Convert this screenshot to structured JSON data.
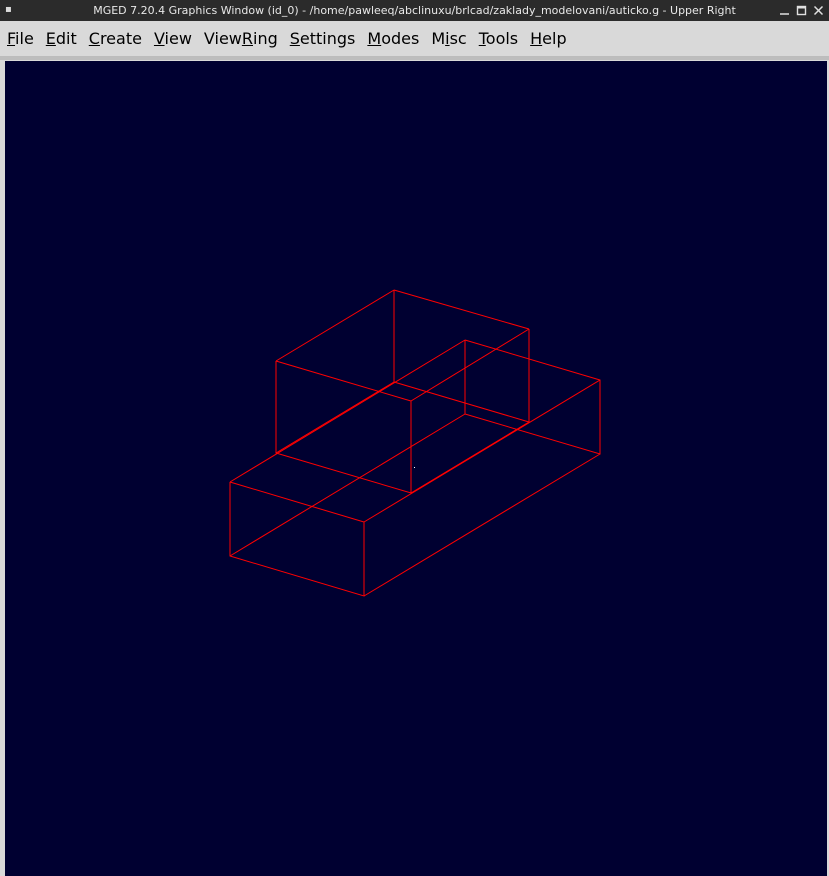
{
  "window": {
    "title": "MGED 7.20.4 Graphics Window (id_0) - /home/pawleeq/abclinuxu/brlcad/zaklady_modelovani/auticko.g - Upper Right",
    "menu_glyph": "▪",
    "controls": {
      "minimize_icon": "minimize-icon",
      "maximize_icon": "maximize-icon",
      "close_icon": "close-icon"
    }
  },
  "menubar": {
    "items": [
      {
        "label": "File",
        "mnemonic": "F",
        "rest": "ile"
      },
      {
        "label": "Edit",
        "mnemonic": "E",
        "rest": "dit"
      },
      {
        "label": "Create",
        "mnemonic": "C",
        "rest": "reate"
      },
      {
        "label": "View",
        "mnemonic": "V",
        "rest": "iew"
      },
      {
        "label": "ViewRing",
        "before": "View",
        "mnemonic": "R",
        "rest": "ing"
      },
      {
        "label": "Settings",
        "mnemonic": "S",
        "rest": "ettings"
      },
      {
        "label": "Modes",
        "mnemonic": "M",
        "rest": "odes"
      },
      {
        "label": "Misc",
        "before": "M",
        "mnemonic": "i",
        "rest": "sc"
      },
      {
        "label": "Tools",
        "mnemonic": "T",
        "rest": "ools"
      },
      {
        "label": "Help",
        "mnemonic": "H",
        "rest": "elp"
      }
    ]
  },
  "viewport": {
    "view": "Upper Right",
    "background": "#000031",
    "wireframe_color": "#ff0000",
    "center_dot_color": "#ffffff"
  }
}
